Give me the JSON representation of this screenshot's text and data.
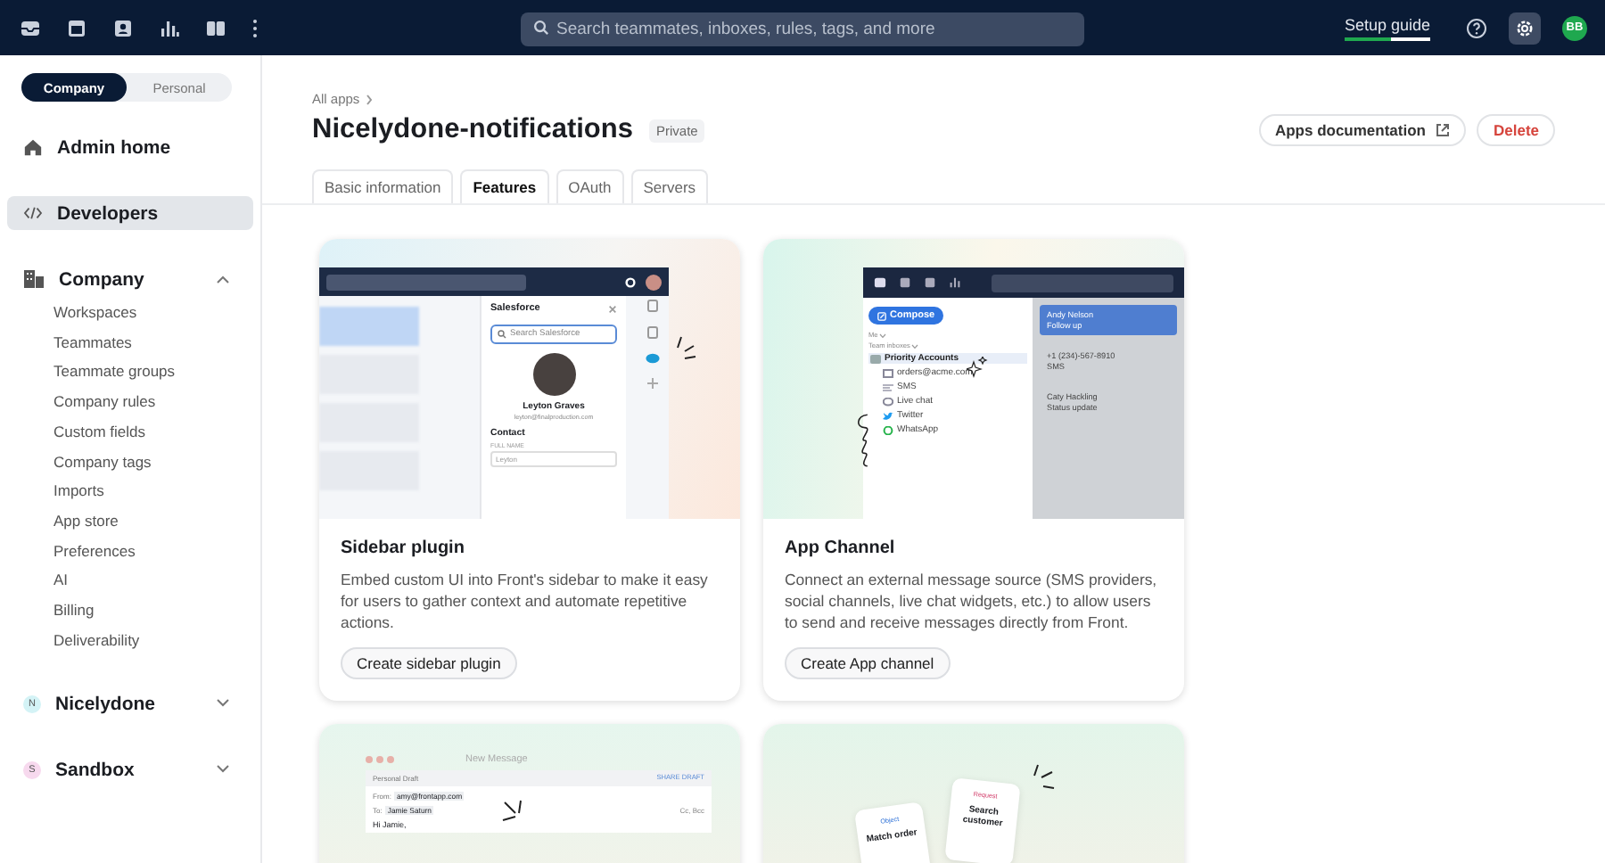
{
  "topbar": {
    "search_placeholder": "Search teammates, inboxes, rules, tags, and more",
    "setup_guide": {
      "label": "Setup guide",
      "level": 0.55
    },
    "avatar": "BB"
  },
  "sidebar": {
    "scopes": [
      {
        "label": "Company",
        "selected": true
      },
      {
        "label": "Personal",
        "selected": false
      }
    ],
    "items": [
      {
        "kind": "home",
        "label": "Admin home",
        "selected": false
      },
      {
        "kind": "code",
        "label": "Developers",
        "selected": true
      },
      {
        "kind": "building",
        "label": "Company",
        "selected": false,
        "expanded": true,
        "children": [
          {
            "label": "Workspaces"
          },
          {
            "label": "Teammates"
          },
          {
            "label": "Teammate groups"
          },
          {
            "label": "Company rules"
          },
          {
            "label": "Custom fields"
          },
          {
            "label": "Company tags"
          },
          {
            "label": "Imports"
          },
          {
            "label": "App store"
          },
          {
            "label": "Preferences"
          },
          {
            "label": "AI"
          },
          {
            "label": "Billing"
          },
          {
            "label": "Deliverability"
          }
        ]
      },
      {
        "kind": "badge",
        "badge": "N",
        "color": "#d4f3f6",
        "label": "Nicelydone",
        "selected": false,
        "expanded": false
      },
      {
        "kind": "badge",
        "badge": "S",
        "color": "#f7d9ee",
        "label": "Sandbox",
        "selected": false,
        "expanded": false
      }
    ]
  },
  "header": {
    "breadcrumb": "All apps",
    "title": "Nicelydone-notifications",
    "badge": "Private",
    "buttons": [
      {
        "kind": "link",
        "label": "Apps documentation"
      },
      {
        "kind": "danger",
        "label": "Delete"
      }
    ]
  },
  "tabs": [
    {
      "label": "Basic information",
      "selected": false
    },
    {
      "label": "Features",
      "selected": true
    },
    {
      "label": "OAuth",
      "selected": false
    },
    {
      "label": "Servers",
      "selected": false
    }
  ],
  "cards": [
    {
      "kind": "sidebar",
      "title": "Sidebar plugin",
      "description": "Embed custom UI into Front's sidebar to make it easy for users to gather context and automate repetitive actions.",
      "button": "Create sidebar plugin",
      "illustration": {
        "panel_title": "Salesforce",
        "search_placeholder": "Search Salesforce",
        "name": "Leyton Graves",
        "email": "leyton@finalproduction.com",
        "section": "Contact",
        "field_label": "FULL NAME",
        "field_value": "Leyton"
      }
    },
    {
      "kind": "channel",
      "title": "App Channel",
      "description": "Connect an external message source (SMS providers, social channels, live chat widgets, etc.) to allow users to send and receive messages directly from Front.",
      "button": "Create App channel",
      "illustration": {
        "compose": "Compose",
        "groups": [
          "Me",
          "Team inboxes"
        ],
        "inboxes": [
          {
            "kind": "inbox",
            "label": "Priority Accounts",
            "selected": true
          },
          {
            "kind": "email",
            "label": "orders@acme.com",
            "selected": false
          },
          {
            "kind": "sms",
            "label": "SMS",
            "selected": false
          },
          {
            "kind": "chat",
            "label": "Live chat",
            "selected": false
          },
          {
            "kind": "twitter",
            "label": "Twitter",
            "selected": false
          },
          {
            "kind": "whatsapp",
            "label": "WhatsApp",
            "selected": false
          }
        ],
        "conversations": [
          {
            "from": "Andy Nelson",
            "subject": "Follow up",
            "selected": true
          },
          {
            "from": "+1 (234)-567-8910",
            "subject": "SMS",
            "selected": false
          },
          {
            "from": "Caty Hackling",
            "subject": "Status update",
            "selected": false
          }
        ]
      }
    },
    {
      "kind": "draft",
      "illustration": {
        "window_title": "New Message",
        "draft_label": "Personal Draft",
        "share": "SHARE DRAFT",
        "from_label": "From:",
        "from": "amy@frontapp.com",
        "to_label": "To:",
        "to": "Jamie Saturn",
        "cc": "Cc, Bcc",
        "greeting": "Hi Jamie,"
      }
    },
    {
      "kind": "workflow",
      "illustration": {
        "steps": [
          {
            "tag": "Object",
            "text": "Match order"
          },
          {
            "tag": "Request",
            "text": "Search customer"
          }
        ]
      }
    }
  ]
}
